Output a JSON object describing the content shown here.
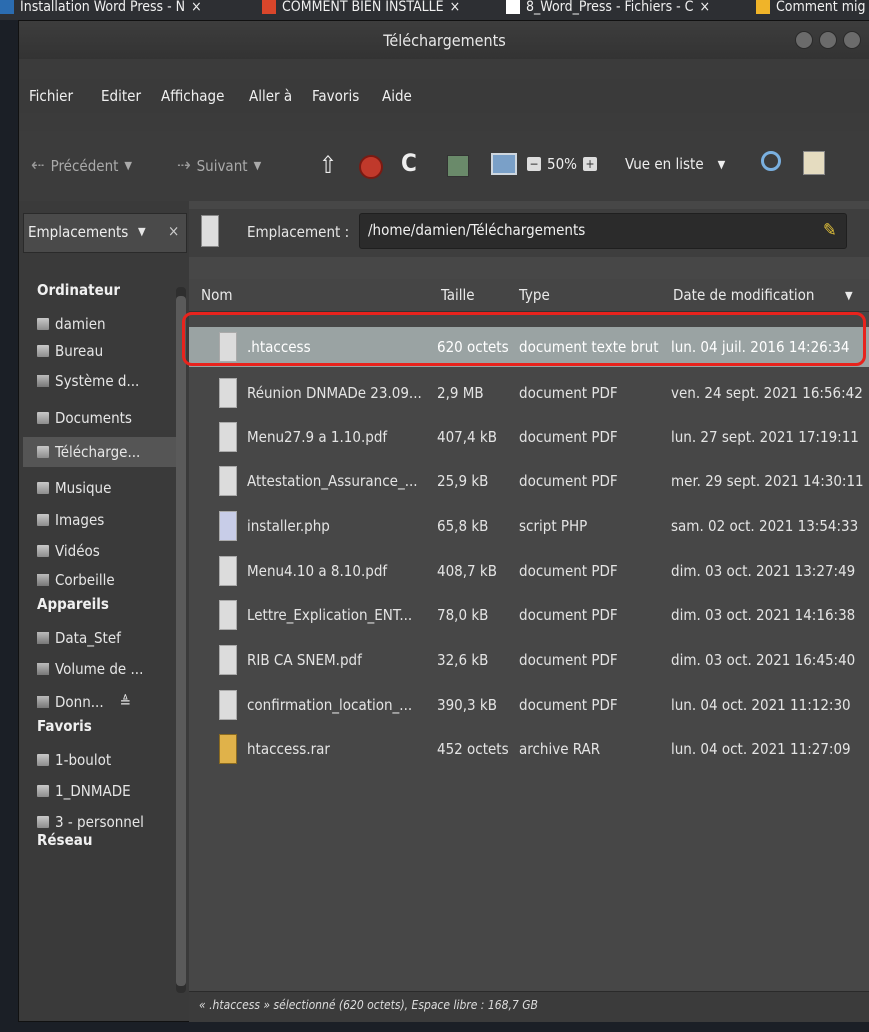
{
  "browser_tabs": [
    {
      "label": "Installation Word Press - N",
      "close": "×",
      "color": "#2b6cb0"
    },
    {
      "label": "COMMENT BIEN INSTALLE",
      "close": "×",
      "color": "#d9462b"
    },
    {
      "label": "8_Word_Press - Fichiers - C",
      "close": "×",
      "color": "#ffffff"
    },
    {
      "label": "Comment mig",
      "close": "",
      "color": "#f0b429"
    }
  ],
  "window": {
    "title": "Téléchargements"
  },
  "menubar": [
    "Fichier",
    "Editer",
    "Affichage",
    "Aller à",
    "Favoris",
    "Aide"
  ],
  "toolbar": {
    "back": "Précédent",
    "forward": "Suivant",
    "zoom": "50%",
    "view": "Vue en liste"
  },
  "sidebar": {
    "header": "Emplacements",
    "close": "×",
    "sections": [
      {
        "title": "Ordinateur",
        "items": [
          "damien",
          "Bureau",
          "Système d...",
          "Documents",
          "Télécharge...",
          "Musique",
          "Images",
          "Vidéos",
          "Corbeille"
        ]
      },
      {
        "title": "Appareils",
        "items": [
          "Data_Stef",
          "Volume de ...",
          "Donn..."
        ]
      },
      {
        "title": "Favoris",
        "items": [
          "1-boulot",
          "1_DNMADE",
          "3 - personnel"
        ]
      },
      {
        "title": "Réseau",
        "items": []
      }
    ],
    "eject": "≜"
  },
  "location": {
    "label": "Emplacement :",
    "path": "/home/damien/Téléchargements"
  },
  "columns": [
    "Nom",
    "Taille",
    "Type",
    "Date de modification"
  ],
  "files": [
    {
      "name": ".htaccess",
      "size": "620 octets",
      "type": "document texte brut",
      "date": "lun. 04 juil. 2016 14:26:34",
      "icon": "text-icon"
    },
    {
      "name": "Réunion DNMADe 23.09...",
      "size": "2,9 MB",
      "type": "document PDF",
      "date": "ven. 24 sept. 2021 16:56:42",
      "icon": "pdf-icon"
    },
    {
      "name": "Menu27.9 a 1.10.pdf",
      "size": "407,4 kB",
      "type": "document PDF",
      "date": "lun. 27 sept. 2021 17:19:11",
      "icon": "pdf-icon"
    },
    {
      "name": "Attestation_Assurance_...",
      "size": "25,9 kB",
      "type": "document PDF",
      "date": "mer. 29 sept. 2021 14:30:11",
      "icon": "pdf-icon"
    },
    {
      "name": "installer.php",
      "size": "65,8 kB",
      "type": "script PHP",
      "date": "sam. 02 oct. 2021 13:54:33",
      "icon": "php-icon"
    },
    {
      "name": "Menu4.10 a 8.10.pdf",
      "size": "408,7 kB",
      "type": "document PDF",
      "date": "dim. 03 oct. 2021 13:27:49",
      "icon": "pdf-icon"
    },
    {
      "name": "Lettre_Explication_ENT...",
      "size": "78,0 kB",
      "type": "document PDF",
      "date": "dim. 03 oct. 2021 14:16:38",
      "icon": "pdf-icon"
    },
    {
      "name": "RIB CA SNEM.pdf",
      "size": "32,6 kB",
      "type": "document PDF",
      "date": "dim. 03 oct. 2021 16:45:40",
      "icon": "pdf-icon"
    },
    {
      "name": "confirmation_location_...",
      "size": "390,3 kB",
      "type": "document PDF",
      "date": "lun. 04 oct. 2021 11:12:30",
      "icon": "pdf-icon"
    },
    {
      "name": "htaccess.rar",
      "size": "452 octets",
      "type": "archive RAR",
      "date": "lun. 04 oct. 2021 11:27:09",
      "icon": "archive-icon"
    }
  ],
  "status": "« .htaccess » sélectionné (620 octets), Espace libre : 168,7 GB",
  "colors": {
    "selection": "#9aa3a3",
    "highlight_outline": "#e8231d"
  }
}
